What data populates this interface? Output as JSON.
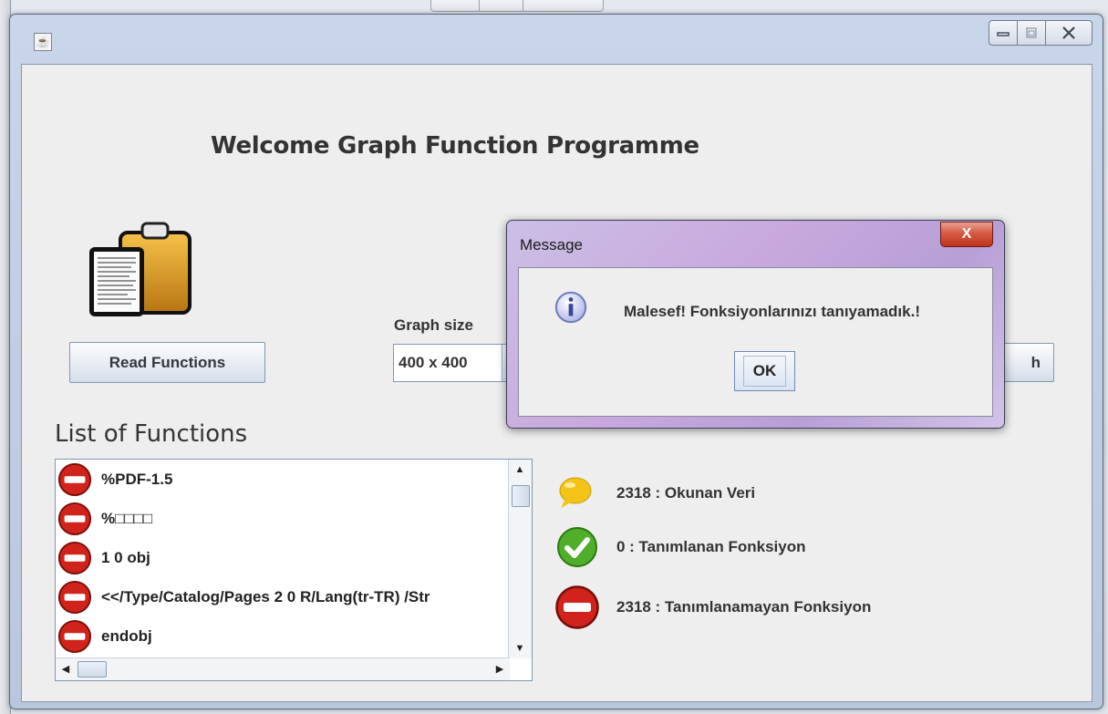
{
  "window": {
    "title": "",
    "app_icon": "java-cup-icon"
  },
  "header": {
    "welcome": "Welcome Graph Function Programme"
  },
  "controls": {
    "read_button": "Read Functions",
    "graph_size_label": "Graph size",
    "graph_size_value": "400 x 400",
    "partial_button_text": "h"
  },
  "list": {
    "title": "List of Functions",
    "items": [
      {
        "text": "%PDF-1.5",
        "icon": "no-entry-icon"
      },
      {
        "text": "%□□□□",
        "icon": "no-entry-icon"
      },
      {
        "text": "1 0 obj",
        "icon": "no-entry-icon"
      },
      {
        "text": "<</Type/Catalog/Pages 2 0 R/Lang(tr-TR) /Str",
        "icon": "no-entry-icon"
      },
      {
        "text": "endobj",
        "icon": "no-entry-icon"
      }
    ]
  },
  "stats": {
    "read": "2318 : Okunan Veri",
    "defined": "0 : Tanımlanan Fonksiyon",
    "undefined": "2318 : Tanımlanamayan Fonksiyon"
  },
  "dialog": {
    "title": "Message",
    "close_label": "X",
    "message": "Malesef! Fonksiyonlarınızı tanıyamadık.!",
    "ok_label": "OK"
  },
  "colors": {
    "no_entry": "#d0231b",
    "check": "#4fae2a",
    "bubble": "#f3c417"
  }
}
